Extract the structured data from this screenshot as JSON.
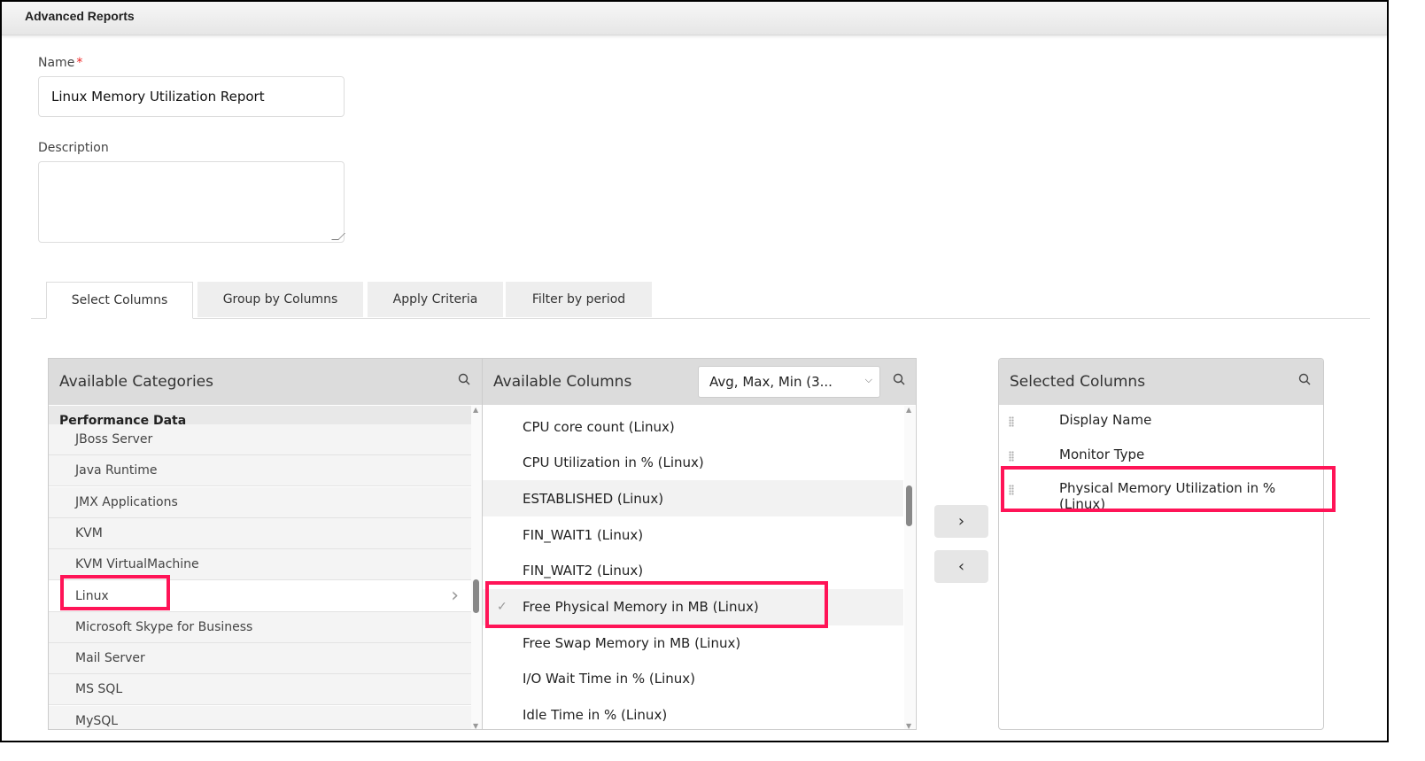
{
  "header": {
    "title": "Advanced Reports"
  },
  "form": {
    "name_label": "Name",
    "required_mark": "*",
    "name_value": "Linux Memory Utilization Report",
    "description_label": "Description",
    "description_value": ""
  },
  "tabs": [
    {
      "label": "Select Columns",
      "active": true
    },
    {
      "label": "Group by Columns"
    },
    {
      "label": "Apply Criteria"
    },
    {
      "label": "Filter by period"
    }
  ],
  "categories": {
    "title": "Available Categories",
    "group": "Performance Data",
    "items": [
      "JBoss Server",
      "Java Runtime",
      "JMX Applications",
      "KVM",
      "KVM VirtualMachine",
      "Linux",
      "Microsoft Skype for Business",
      "Mail Server",
      "MS SQL",
      "MySQL"
    ],
    "selected": "Linux"
  },
  "columns": {
    "title": "Available Columns",
    "aggregate": "Avg, Max, Min (3...",
    "items": [
      "CPU core count (Linux)",
      "CPU Utilization in % (Linux)",
      "ESTABLISHED (Linux)",
      "FIN_WAIT1 (Linux)",
      "FIN_WAIT2 (Linux)",
      "Free Physical Memory in MB (Linux)",
      "Free Swap Memory in MB (Linux)",
      "I/O Wait Time in % (Linux)",
      "Idle Time in % (Linux)"
    ],
    "checked": "Free Physical Memory in MB (Linux)"
  },
  "buttons": {
    "add": "›",
    "remove": "‹"
  },
  "selected": {
    "title": "Selected Columns",
    "items": [
      "Display Name",
      "Monitor Type",
      "Physical Memory Utilization in % (Linux)"
    ]
  },
  "colors": {
    "highlight": "#ff1457",
    "header_bg": "#dcdcdc"
  }
}
